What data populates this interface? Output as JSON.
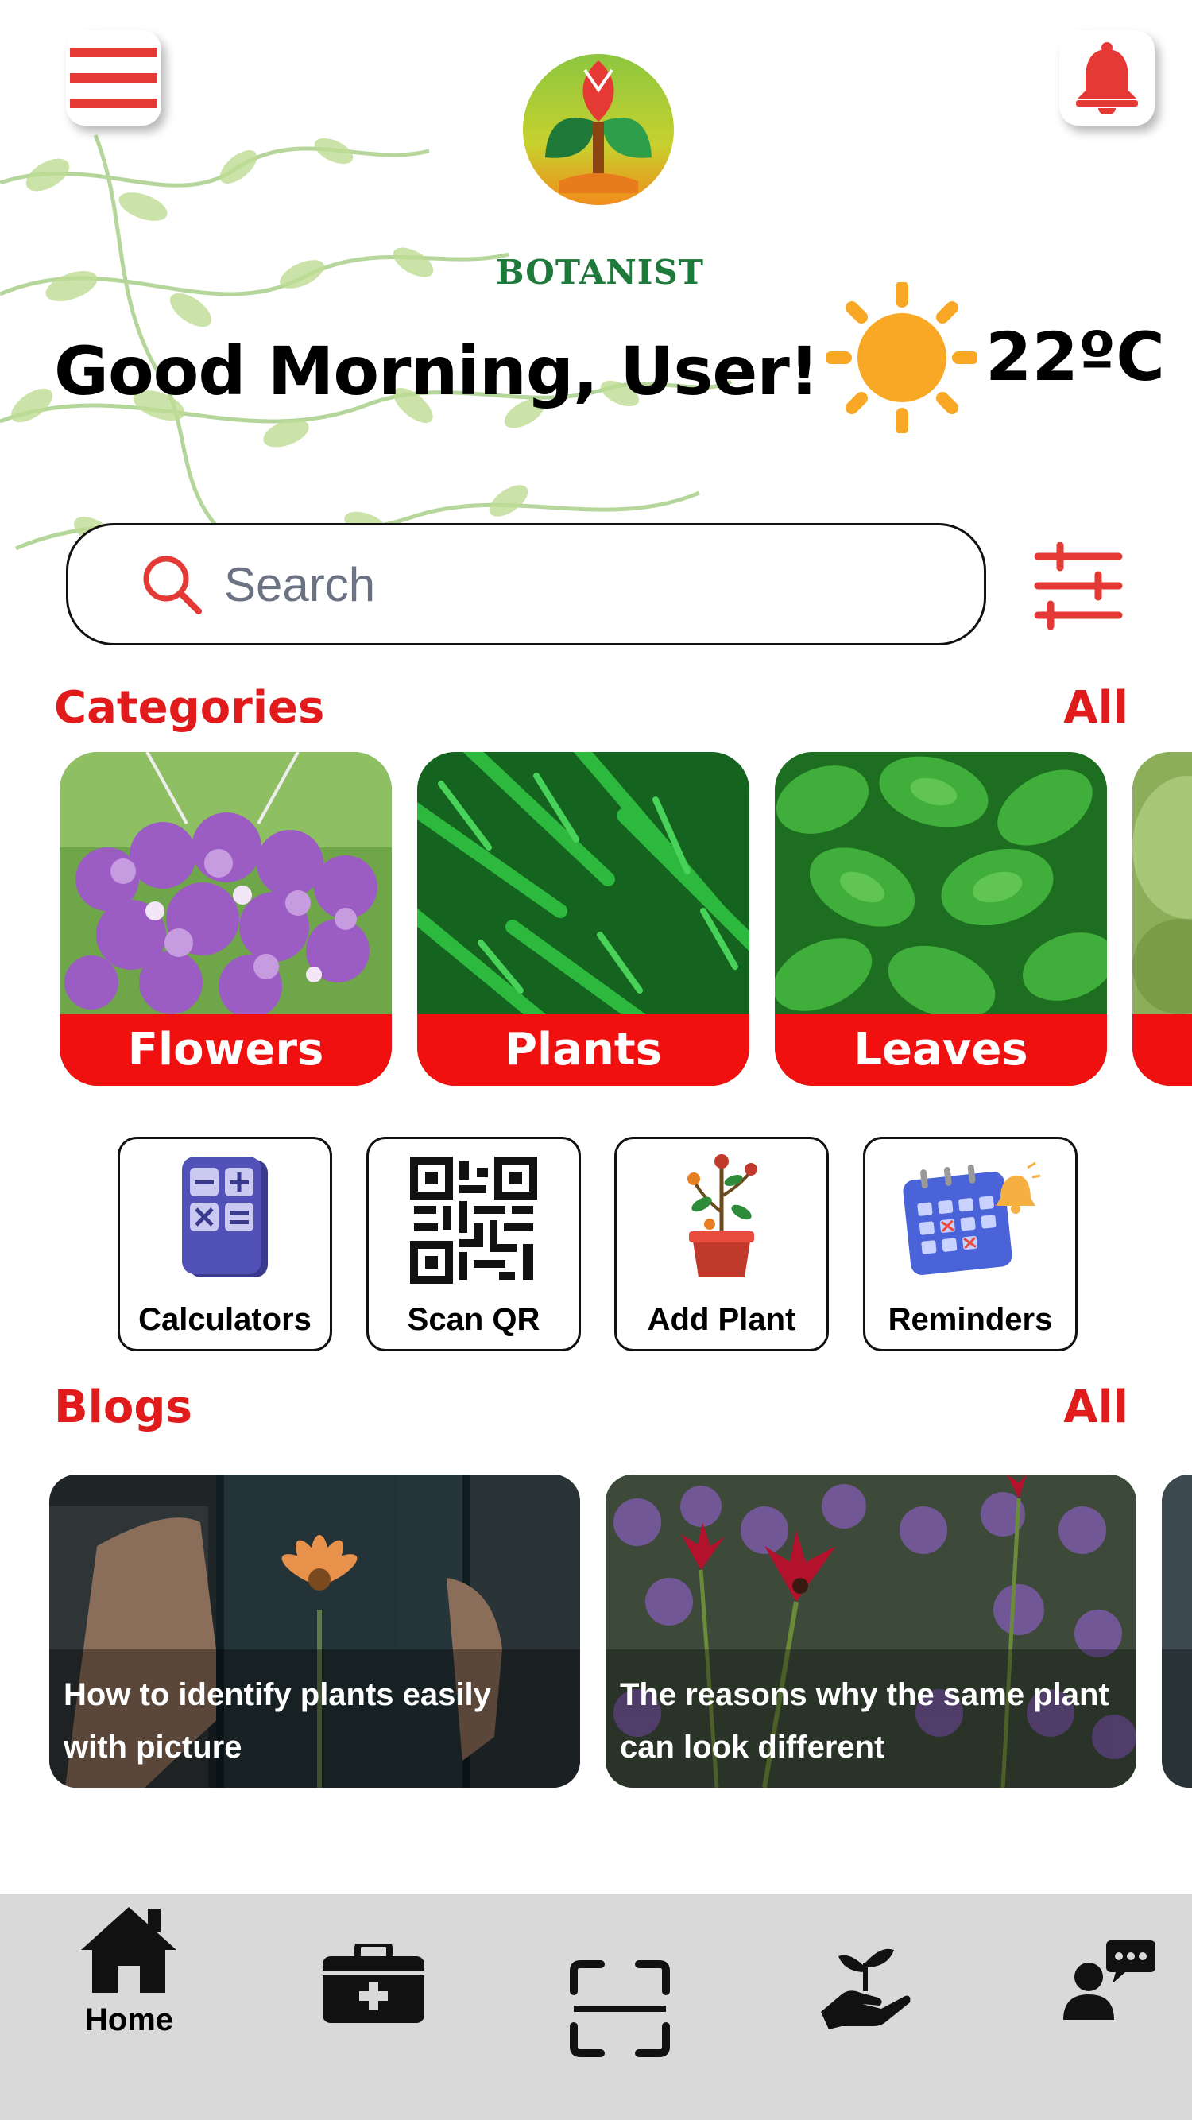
{
  "header": {
    "menu_icon": "hamburger-menu-icon",
    "notification_icon": "bell-icon",
    "brand_name": "BOTANIST",
    "greeting": "Good Morning, User!",
    "weather_icon": "sun-icon",
    "temperature": "22ºC"
  },
  "search": {
    "placeholder": "Search",
    "filter_icon": "sliders-icon"
  },
  "categories": {
    "title": "Categories",
    "all_link": "All",
    "items": [
      {
        "label": "Flowers"
      },
      {
        "label": "Plants"
      },
      {
        "label": "Leaves"
      }
    ]
  },
  "tools": [
    {
      "label": "Calculators",
      "icon": "calculator-icon"
    },
    {
      "label": "Scan QR",
      "icon": "qr-code-icon"
    },
    {
      "label": "Add Plant",
      "icon": "potted-plant-icon"
    },
    {
      "label": "Reminders",
      "icon": "calendar-bell-icon"
    }
  ],
  "blogs": {
    "title": "Blogs",
    "all_link": "All",
    "items": [
      {
        "title": "How to identify plants easily with picture"
      },
      {
        "title": "The reasons why the same plant can look different"
      }
    ]
  },
  "nav": {
    "items": [
      {
        "label": "Home",
        "icon": "home-icon",
        "active": true
      },
      {
        "label": "",
        "icon": "medical-kit-icon"
      },
      {
        "label": "",
        "icon": "scan-icon"
      },
      {
        "label": "",
        "icon": "plant-hand-icon"
      },
      {
        "label": "",
        "icon": "expert-chat-icon"
      }
    ]
  },
  "colors": {
    "accent_red": "#e11b1b",
    "label_red": "#f01010",
    "brand_green": "#1e7a3a",
    "nav_bg": "#d9d9d9",
    "sun": "#f9a825"
  }
}
